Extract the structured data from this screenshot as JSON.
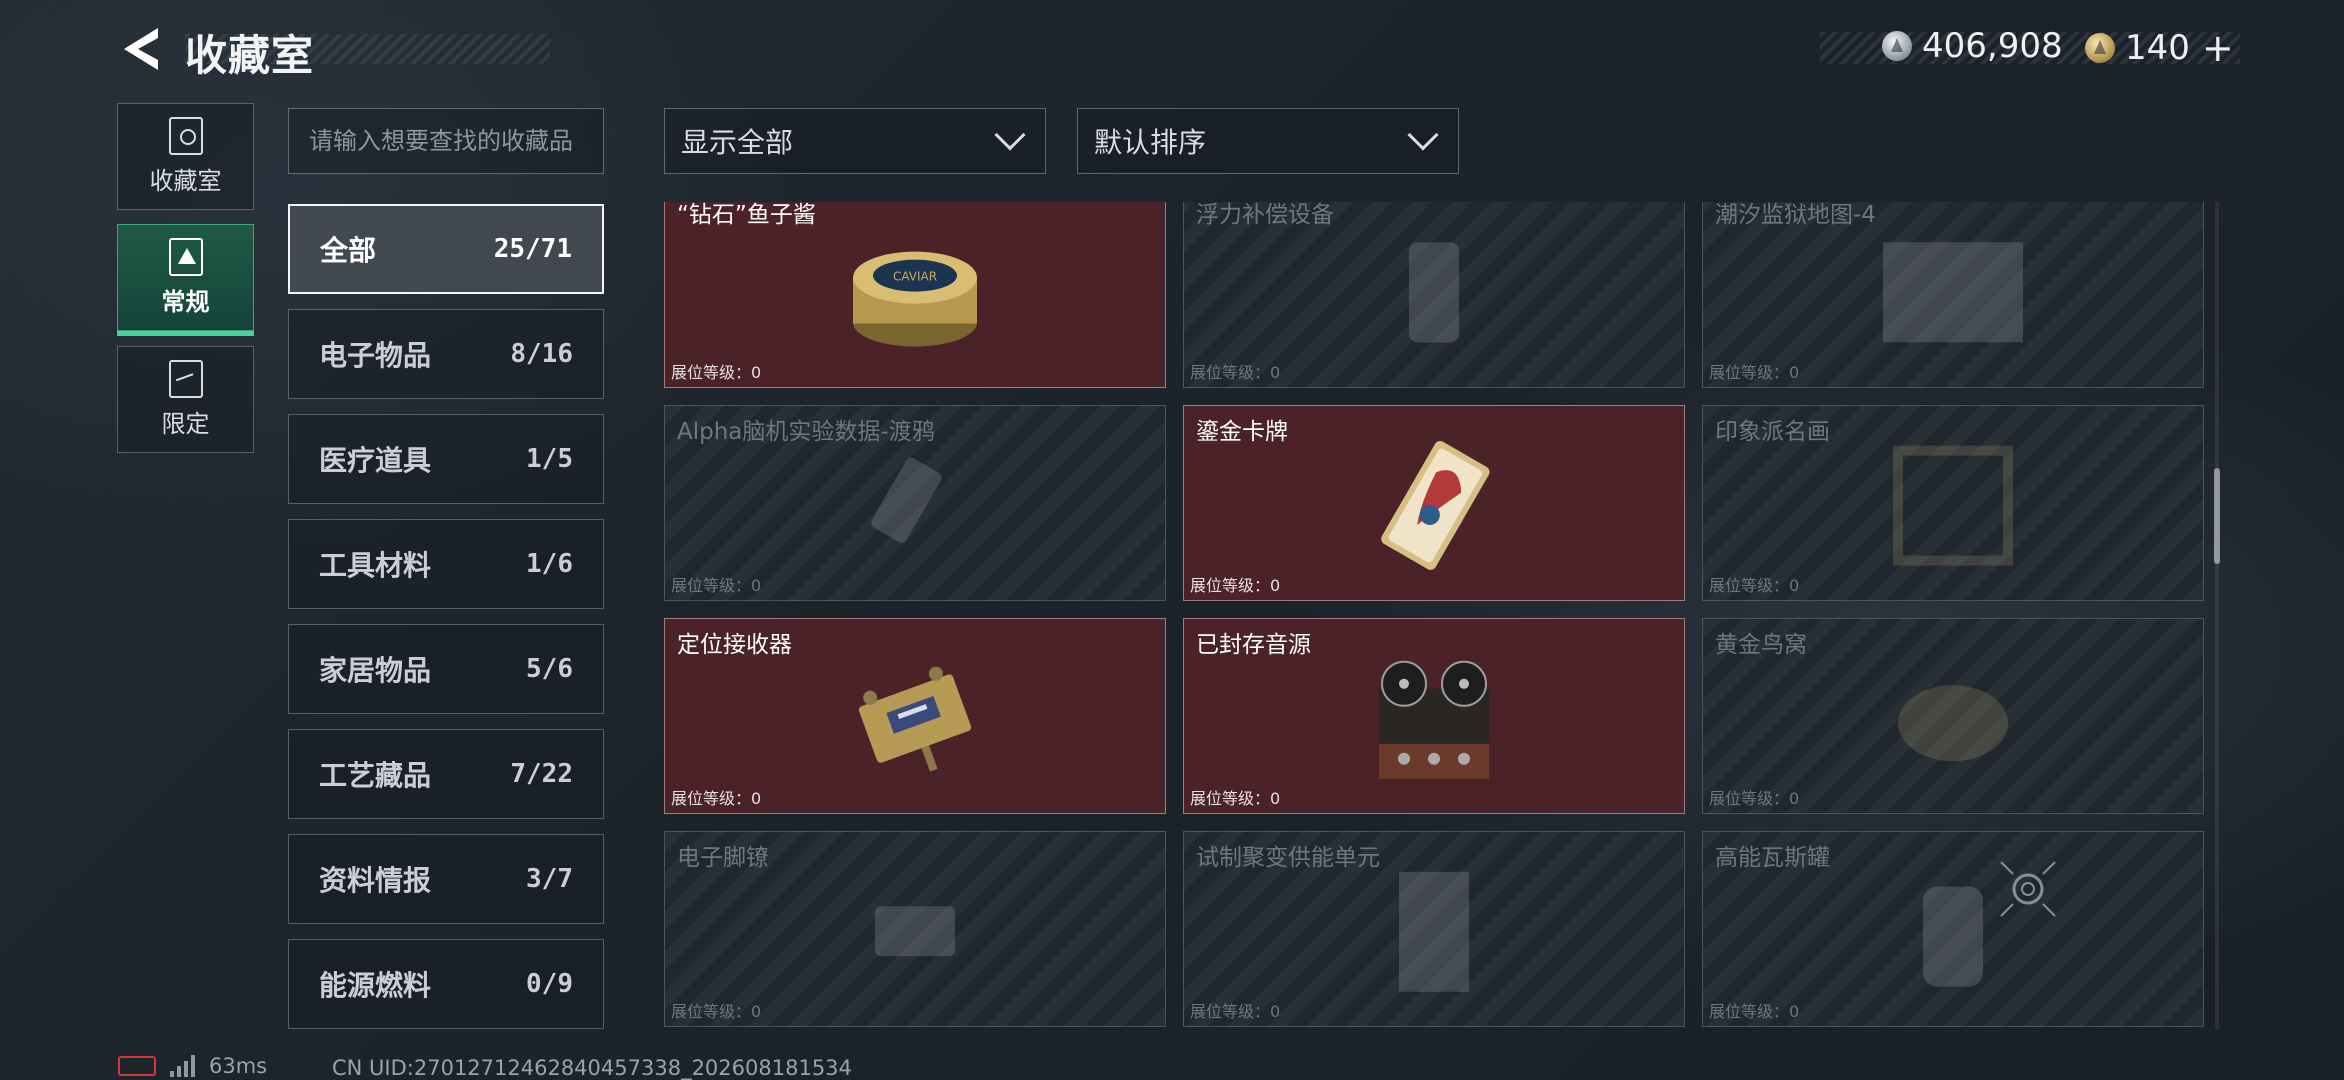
{
  "header": {
    "title": "收藏室",
    "currency_primary": "406,908",
    "currency_secondary": "140",
    "currency_secondary_suffix": "+"
  },
  "nav": [
    {
      "label": "收藏室",
      "icon": "vault-icon"
    },
    {
      "label": "常规",
      "icon": "regular-icon",
      "active": true
    },
    {
      "label": "限定",
      "icon": "limited-icon"
    }
  ],
  "search": {
    "placeholder": "请输入想要查找的收藏品"
  },
  "filters": {
    "show": "显示全部",
    "sort": "默认排序"
  },
  "categories": [
    {
      "name": "全部",
      "count": "25/71",
      "active": true
    },
    {
      "name": "电子物品",
      "count": "8/16"
    },
    {
      "name": "医疗道具",
      "count": "1/5"
    },
    {
      "name": "工具材料",
      "count": "1/6"
    },
    {
      "name": "家居物品",
      "count": "5/6"
    },
    {
      "name": "工艺藏品",
      "count": "7/22"
    },
    {
      "name": "资料情报",
      "count": "3/7"
    },
    {
      "name": "能源燃料",
      "count": "0/9"
    }
  ],
  "level_label": "展位等级：0",
  "items": [
    {
      "name": "“钻石”鱼子酱",
      "owned": true,
      "icon": "caviar-tin-icon"
    },
    {
      "name": "浮力补偿设备",
      "owned": false,
      "icon": "buoyancy-device-icon"
    },
    {
      "name": "潮汐监狱地图-4",
      "owned": false,
      "icon": "map-icon"
    },
    {
      "name": "Alpha脑机实验数据-渡鸦",
      "owned": false,
      "icon": "data-drive-icon"
    },
    {
      "name": "鎏金卡牌",
      "owned": true,
      "icon": "gilded-card-icon"
    },
    {
      "name": "印象派名画",
      "owned": false,
      "icon": "painting-icon"
    },
    {
      "name": "定位接收器",
      "owned": true,
      "icon": "gps-receiver-icon"
    },
    {
      "name": "已封存音源",
      "owned": true,
      "icon": "reel-recorder-icon"
    },
    {
      "name": "黄金鸟窝",
      "owned": false,
      "icon": "golden-nest-icon"
    },
    {
      "name": "电子脚镣",
      "owned": false,
      "icon": "ankle-monitor-icon"
    },
    {
      "name": "试制聚变供能单元",
      "owned": false,
      "icon": "fusion-unit-icon"
    },
    {
      "name": "高能瓦斯罐",
      "owned": false,
      "icon": "gas-canister-icon"
    }
  ],
  "footer": {
    "ping": "63ms",
    "uid": "CN UID:27012712462840457338_202608181534"
  },
  "colors": {
    "owned_card": "#4a2227",
    "accent_green": "#47d39b",
    "background": "#1c232a"
  }
}
